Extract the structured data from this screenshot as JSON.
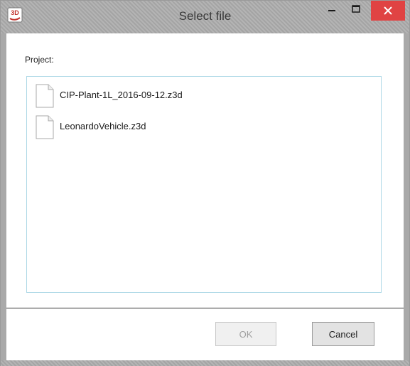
{
  "window": {
    "title": "Select file",
    "app_icon": "app-3d-icon",
    "app_icon_text": "3D",
    "controls": {
      "minimize_icon": "minimize-icon",
      "maximize_icon": "maximize-icon",
      "close_icon": "close-icon"
    }
  },
  "dialog": {
    "project_label": "Project:",
    "files": [
      {
        "name": "CIP-Plant-1L_2016-09-12.z3d",
        "icon": "document-icon"
      },
      {
        "name": "LeonardoVehicle.z3d",
        "icon": "document-icon"
      }
    ],
    "ok_label": "OK",
    "cancel_label": "Cancel"
  },
  "colors": {
    "close_button": "#e04343",
    "list_border": "#add8e6",
    "disabled_text": "#a0a0a0"
  }
}
